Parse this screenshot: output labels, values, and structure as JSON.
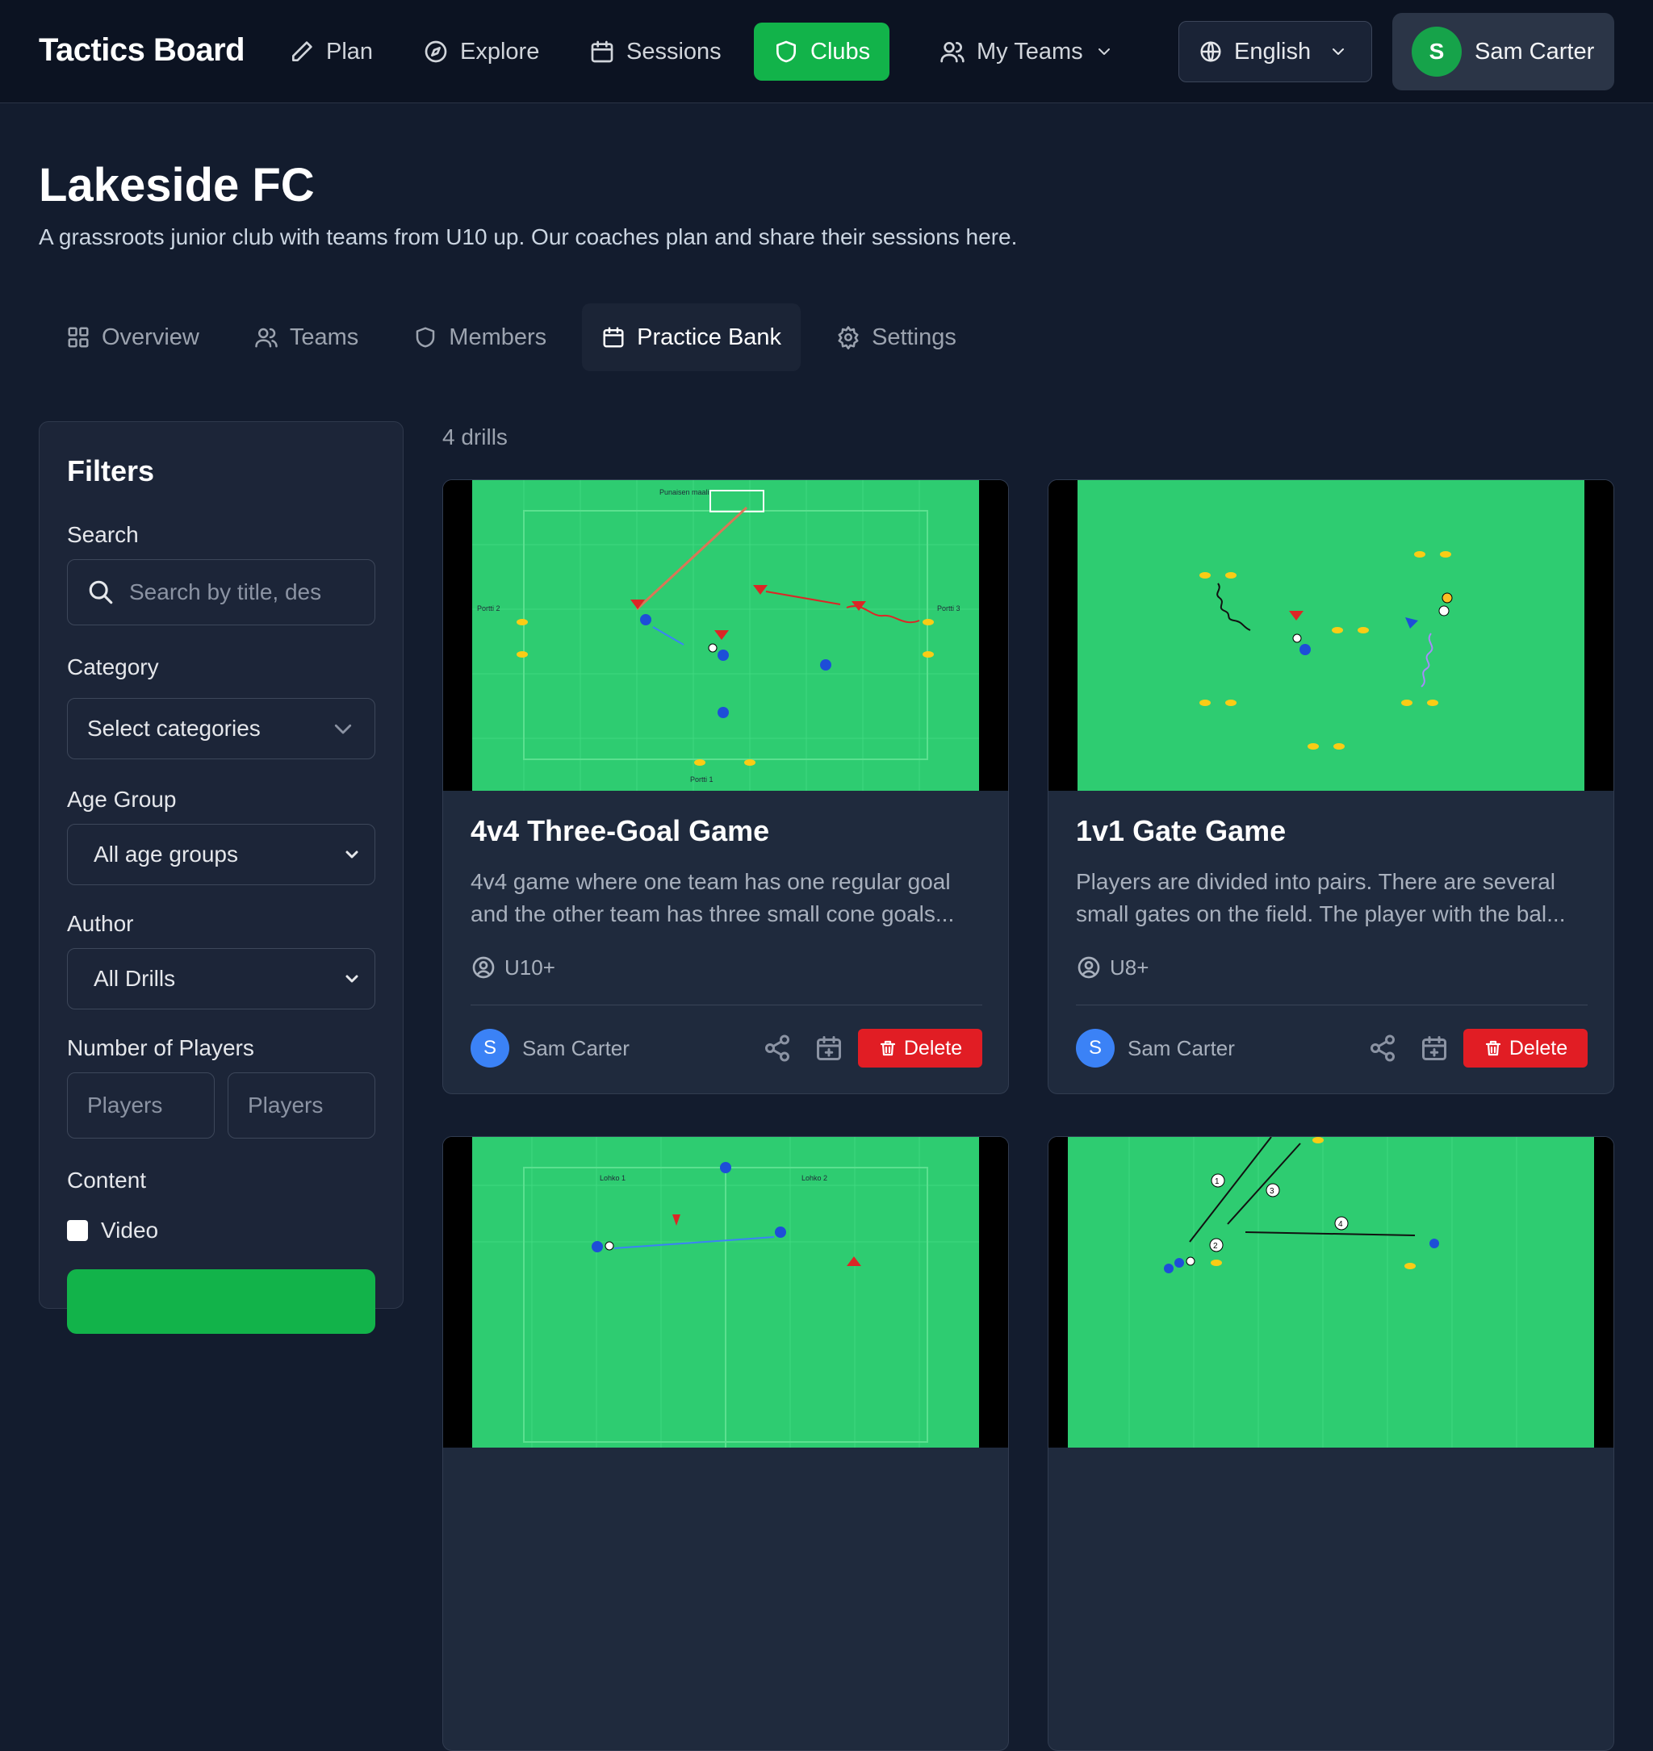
{
  "nav": {
    "brand": "Tactics Board",
    "items": [
      {
        "label": "Plan",
        "icon": "pencil-icon"
      },
      {
        "label": "Explore",
        "icon": "compass-icon"
      },
      {
        "label": "Sessions",
        "icon": "calendar-icon"
      },
      {
        "label": "Clubs",
        "icon": "shield-icon",
        "active": true
      },
      {
        "label": "My Teams",
        "icon": "users-icon"
      }
    ],
    "language": "English",
    "user": {
      "initial": "S",
      "name": "Sam Carter"
    }
  },
  "club": {
    "name": "Lakeside FC",
    "description": "A grassroots junior club with teams from U10 up. Our coaches plan and share their sessions here."
  },
  "tabs": [
    {
      "label": "Overview",
      "icon": "grid-icon"
    },
    {
      "label": "Teams",
      "icon": "users-icon"
    },
    {
      "label": "Members",
      "icon": "shield-icon"
    },
    {
      "label": "Practice Bank",
      "icon": "calendar-icon",
      "active": true
    },
    {
      "label": "Settings",
      "icon": "gear-icon"
    }
  ],
  "filters": {
    "title": "Filters",
    "search_label": "Search",
    "search_placeholder": "Search by title, des",
    "category_label": "Category",
    "category_value": "Select categories",
    "age_label": "Age Group",
    "age_value": "All age groups",
    "author_label": "Author",
    "author_value": "All Drills",
    "players_label": "Number of Players",
    "players_min_placeholder": "Players",
    "players_max_placeholder": "Players",
    "content_label": "Content",
    "video_label": "Video"
  },
  "results": {
    "count": "4 drills",
    "drills": [
      {
        "title": "4v4 Three-Goal Game",
        "description": "4v4 game where one team has one regular goal and the other team has three small cone goals...",
        "age": "U10+",
        "author_initial": "S",
        "author": "Sam Carter",
        "delete_label": "Delete",
        "field_labels": [
          "Punaisen maali",
          "Portti 2",
          "Portti 3",
          "Portti 1"
        ]
      },
      {
        "title": "1v1 Gate Game",
        "description": "Players are divided into pairs. There are several small gates on the field. The player with the bal...",
        "age": "U8+",
        "author_initial": "S",
        "author": "Sam Carter",
        "delete_label": "Delete"
      },
      {
        "field_labels": [
          "Lohko 1",
          "Lohko 2"
        ]
      },
      {
        "player_numbers": [
          "1",
          "3",
          "4",
          "2"
        ]
      }
    ]
  },
  "colors": {
    "accent_green": "#12b34a",
    "danger_red": "#e11d24",
    "avatar_blue": "#3b82f6",
    "pitch_green": "#2ecc71"
  }
}
